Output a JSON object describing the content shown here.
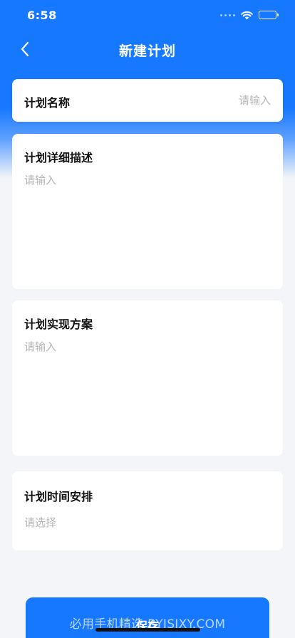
{
  "status": {
    "time": "6:58"
  },
  "nav": {
    "title": "新建计划"
  },
  "form": {
    "name": {
      "label": "计划名称",
      "placeholder": "请输入"
    },
    "description": {
      "label": "计划详细描述",
      "placeholder": "请输入"
    },
    "plan": {
      "label": "计划实现方案",
      "placeholder": "请输入"
    },
    "schedule": {
      "label": "计划时间安排",
      "placeholder": "请选择"
    }
  },
  "footer": {
    "save_label": "保存",
    "watermark": "必用手机精选 BYJSJXY.COM"
  },
  "colors": {
    "primary": "#1677ff",
    "background": "#f4f5f8",
    "card": "#ffffff",
    "placeholder": "#b5b5b5"
  }
}
